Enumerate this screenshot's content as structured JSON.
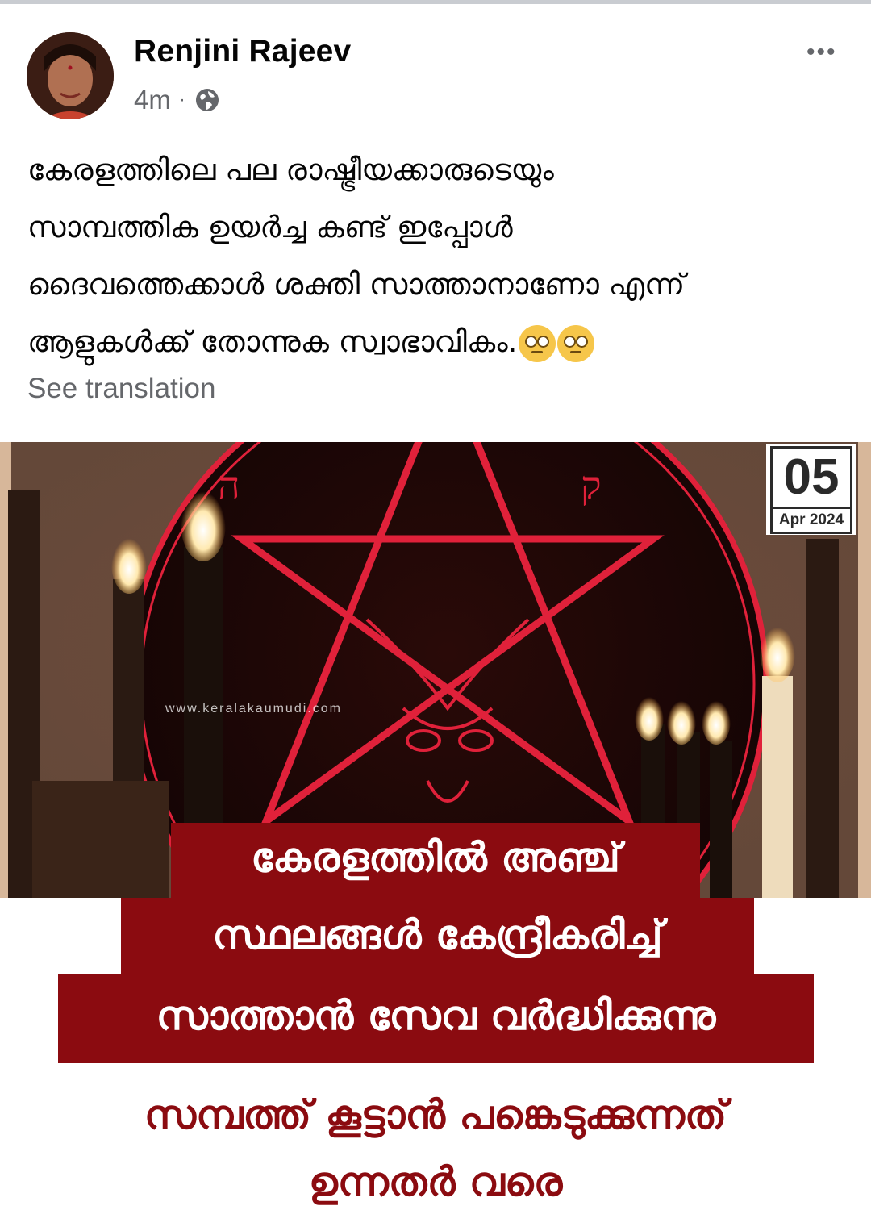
{
  "post": {
    "author": "Renjini Rajeev",
    "time": "4m",
    "separator": "·",
    "audience_icon": "globe-icon",
    "more_icon": "more-options-icon",
    "more_glyph": "•••",
    "text_lines": [
      "കേരളത്തിലെ പല രാഷ്ട്രീയക്കാരുടെയും",
      "സാമ്പത്തിക ഉയർച്ച കണ്ട് ഇപ്പോൾ",
      "ദൈവത്തെക്കാൾ ശക്തി സാത്താനാണോ എന്ന്",
      "ആളുകൾക്ക് തോന്നുക സ്വാഭാവികം."
    ],
    "emojis": [
      "face-with-rolling-eyes",
      "face-with-rolling-eyes"
    ],
    "see_translation": "See translation"
  },
  "news_image": {
    "watermark": "www.keralakaumudi.com",
    "date_day": "05",
    "date_month": "Apr 2024",
    "headline_lines": [
      "കേരളത്തിൽ അഞ്ച്",
      "സ്ഥലങ്ങൾ കേന്ദ്രീകരിച്ച്",
      "സാത്താൻ സേവ വർദ്ധിക്കുന്നു"
    ],
    "subheadline_lines": [
      "സമ്പത്ത് കൂട്ടാൻ പങ്കെടുക്കുന്നത്",
      "ഉന്നതർ വരെ"
    ],
    "colors": {
      "headline_bg": "#8b0b10",
      "pentagram": "#e0213a"
    }
  }
}
